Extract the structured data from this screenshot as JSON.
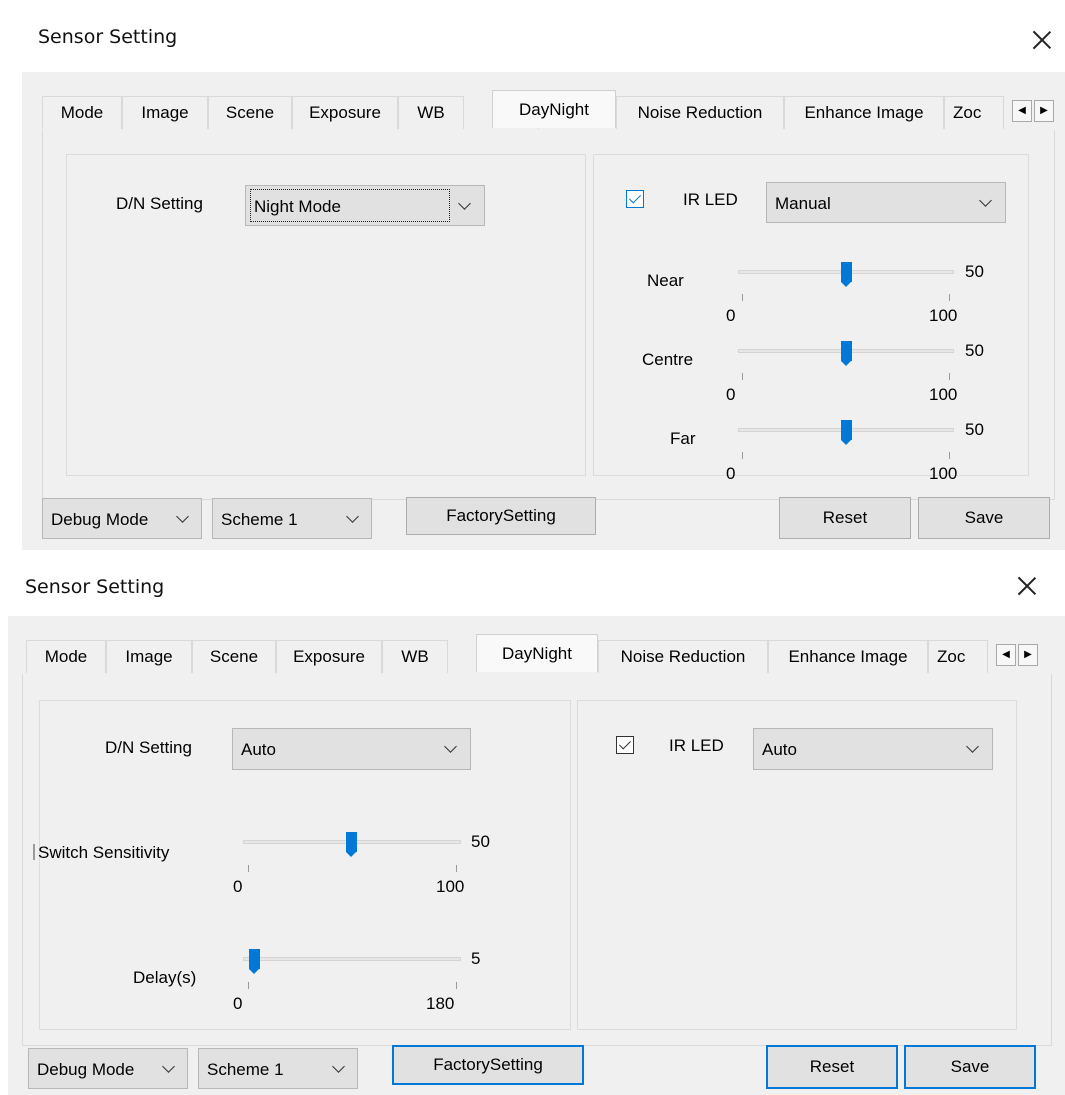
{
  "dialogs": [
    {
      "title": "Sensor Setting",
      "tabs": [
        "Mode",
        "Image",
        "Scene",
        "Exposure",
        "WB",
        "DayNight",
        "Noise Reduction",
        "Enhance Image",
        "Zoc"
      ],
      "active_tab": "DayNight",
      "dn_setting": {
        "label": "D/N Setting",
        "value": "Night Mode"
      },
      "ir_led": {
        "label": "IR LED",
        "checked": true,
        "mode": "Manual"
      },
      "sliders": [
        {
          "label": "Near",
          "value": "50",
          "min": "0",
          "max": "100"
        },
        {
          "label": "Centre",
          "value": "50",
          "min": "0",
          "max": "100"
        },
        {
          "label": "Far",
          "value": "50",
          "min": "0",
          "max": "100"
        }
      ],
      "footer": {
        "debug_mode": "Debug Mode",
        "scheme": "Scheme 1",
        "factory_button": "FactorySetting",
        "reset_button": "Reset",
        "save_button": "Save"
      }
    },
    {
      "title": "Sensor Setting",
      "tabs": [
        "Mode",
        "Image",
        "Scene",
        "Exposure",
        "WB",
        "DayNight",
        "Noise Reduction",
        "Enhance Image",
        "Zoc"
      ],
      "active_tab": "DayNight",
      "dn_setting": {
        "label": "D/N Setting",
        "value": "Auto"
      },
      "ir_led": {
        "label": "IR LED",
        "checked": true,
        "mode": "Auto"
      },
      "sliders": [
        {
          "label": "Switch Sensitivity",
          "value": "50",
          "min": "0",
          "max": "100"
        },
        {
          "label": "Delay(s)",
          "value": "5",
          "min": "0",
          "max": "180"
        }
      ],
      "footer": {
        "debug_mode": "Debug Mode",
        "scheme": "Scheme 1",
        "factory_button": "FactorySetting",
        "reset_button": "Reset",
        "save_button": "Save"
      }
    }
  ],
  "icons": {
    "close": "close-icon",
    "tab_scroll_left": "triangle-left-icon",
    "tab_scroll_right": "triangle-right-icon",
    "dropdown": "chevron-down-icon",
    "checkbox": "checkmark-icon"
  },
  "colors": {
    "accent": "#0078d7",
    "client_bg": "#f0f0f0",
    "button_bg": "#e1e1e1"
  }
}
